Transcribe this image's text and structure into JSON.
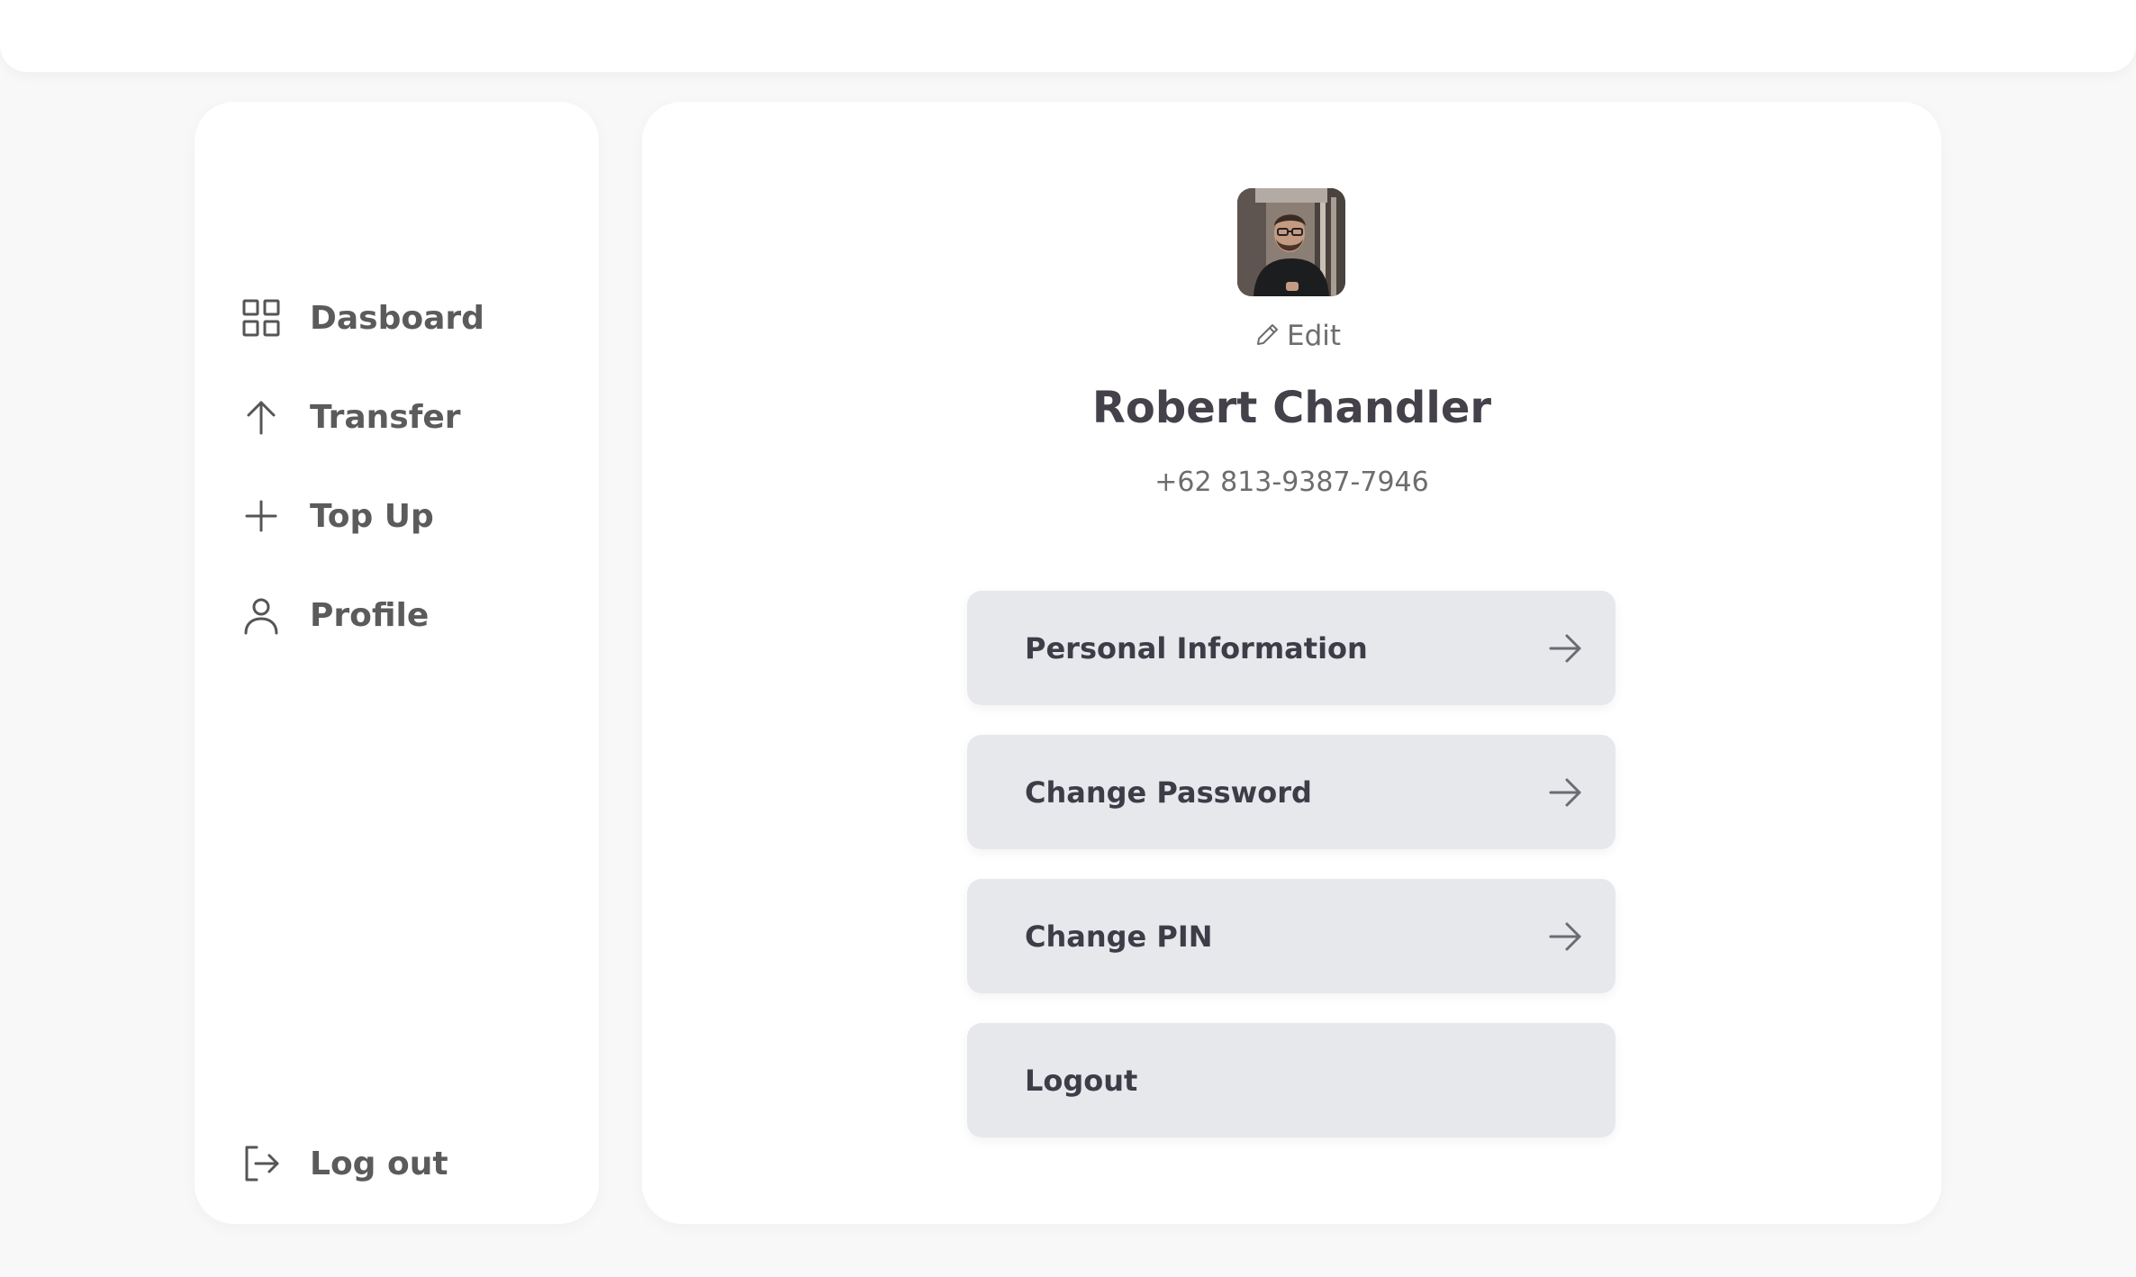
{
  "sidebar": {
    "items": [
      {
        "label": "Dasboard",
        "icon": "grid-icon"
      },
      {
        "label": "Transfer",
        "icon": "arrow-up-icon"
      },
      {
        "label": "Top Up",
        "icon": "plus-icon"
      },
      {
        "label": "Profile",
        "icon": "user-icon"
      }
    ],
    "logout": {
      "label": "Log out",
      "icon": "logout-icon"
    }
  },
  "profile": {
    "edit_label": "Edit",
    "name": "Robert Chandler",
    "phone": "+62 813-9387-7946"
  },
  "menu": [
    {
      "label": "Personal Information",
      "icon": "arrow-right-icon"
    },
    {
      "label": "Change Password",
      "icon": "arrow-right-icon"
    },
    {
      "label": "Change PIN",
      "icon": "arrow-right-icon"
    },
    {
      "label": "Logout"
    }
  ],
  "colors": {
    "background": "#f8f8f8",
    "card": "#ffffff",
    "button": "#e6e8ec",
    "text_dark": "#45414a",
    "text_muted": "#6d6d6d"
  }
}
